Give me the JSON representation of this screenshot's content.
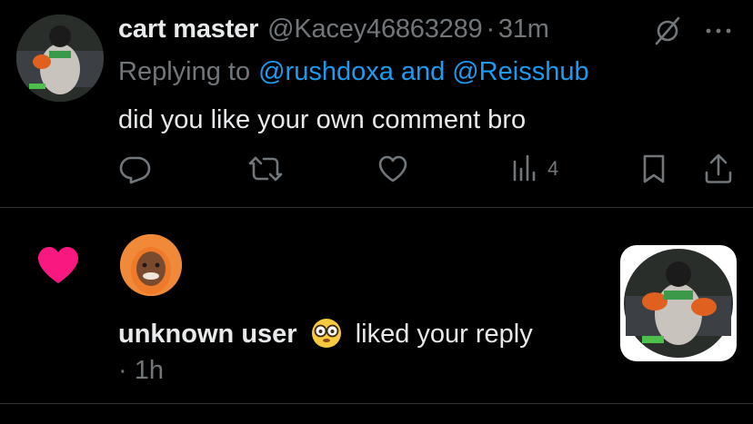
{
  "reply": {
    "display_name": "cart master",
    "handle": "@Kacey46863289",
    "separator": "·",
    "time": "31m",
    "replying_prefix": "Replying to",
    "replying_users": [
      "@rushdoxa",
      "@Reisshub"
    ],
    "replying_and": "and",
    "text": "did you like your own comment bro",
    "views_count": "4",
    "icons": {
      "grok": "grok-icon",
      "more": "more-icon",
      "reply": "reply-icon",
      "retweet": "retweet-icon",
      "like": "heart-outline-icon",
      "views": "views-icon",
      "bookmark": "bookmark-icon",
      "share": "share-icon"
    }
  },
  "notification": {
    "icon": "heart-icon",
    "user": "unknown user",
    "emoji": "face-with-glasses-emoji",
    "action": "liked your reply",
    "separator": "·",
    "time": "1h"
  },
  "colors": {
    "background": "#000000",
    "text": "#e7e9ea",
    "muted": "#71767b",
    "link": "#1d9bf0",
    "heart": "#f91880",
    "divider": "#2f3336"
  }
}
